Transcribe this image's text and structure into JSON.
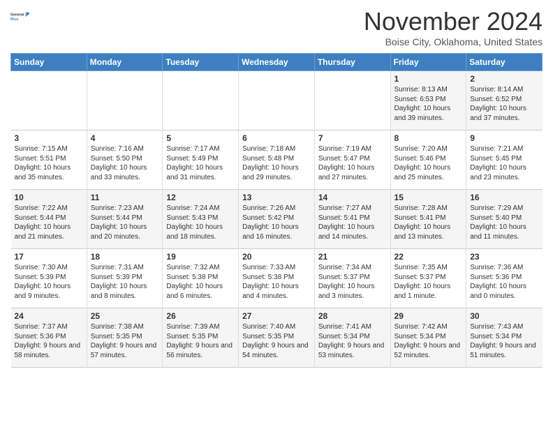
{
  "header": {
    "logo_line1": "General",
    "logo_line2": "Blue",
    "month": "November 2024",
    "location": "Boise City, Oklahoma, United States"
  },
  "weekdays": [
    "Sunday",
    "Monday",
    "Tuesday",
    "Wednesday",
    "Thursday",
    "Friday",
    "Saturday"
  ],
  "weeks": [
    [
      {
        "day": "",
        "info": ""
      },
      {
        "day": "",
        "info": ""
      },
      {
        "day": "",
        "info": ""
      },
      {
        "day": "",
        "info": ""
      },
      {
        "day": "",
        "info": ""
      },
      {
        "day": "1",
        "info": "Sunrise: 8:13 AM\nSunset: 6:53 PM\nDaylight: 10 hours and 39 minutes."
      },
      {
        "day": "2",
        "info": "Sunrise: 8:14 AM\nSunset: 6:52 PM\nDaylight: 10 hours and 37 minutes."
      }
    ],
    [
      {
        "day": "3",
        "info": "Sunrise: 7:15 AM\nSunset: 5:51 PM\nDaylight: 10 hours and 35 minutes."
      },
      {
        "day": "4",
        "info": "Sunrise: 7:16 AM\nSunset: 5:50 PM\nDaylight: 10 hours and 33 minutes."
      },
      {
        "day": "5",
        "info": "Sunrise: 7:17 AM\nSunset: 5:49 PM\nDaylight: 10 hours and 31 minutes."
      },
      {
        "day": "6",
        "info": "Sunrise: 7:18 AM\nSunset: 5:48 PM\nDaylight: 10 hours and 29 minutes."
      },
      {
        "day": "7",
        "info": "Sunrise: 7:19 AM\nSunset: 5:47 PM\nDaylight: 10 hours and 27 minutes."
      },
      {
        "day": "8",
        "info": "Sunrise: 7:20 AM\nSunset: 5:46 PM\nDaylight: 10 hours and 25 minutes."
      },
      {
        "day": "9",
        "info": "Sunrise: 7:21 AM\nSunset: 5:45 PM\nDaylight: 10 hours and 23 minutes."
      }
    ],
    [
      {
        "day": "10",
        "info": "Sunrise: 7:22 AM\nSunset: 5:44 PM\nDaylight: 10 hours and 21 minutes."
      },
      {
        "day": "11",
        "info": "Sunrise: 7:23 AM\nSunset: 5:44 PM\nDaylight: 10 hours and 20 minutes."
      },
      {
        "day": "12",
        "info": "Sunrise: 7:24 AM\nSunset: 5:43 PM\nDaylight: 10 hours and 18 minutes."
      },
      {
        "day": "13",
        "info": "Sunrise: 7:26 AM\nSunset: 5:42 PM\nDaylight: 10 hours and 16 minutes."
      },
      {
        "day": "14",
        "info": "Sunrise: 7:27 AM\nSunset: 5:41 PM\nDaylight: 10 hours and 14 minutes."
      },
      {
        "day": "15",
        "info": "Sunrise: 7:28 AM\nSunset: 5:41 PM\nDaylight: 10 hours and 13 minutes."
      },
      {
        "day": "16",
        "info": "Sunrise: 7:29 AM\nSunset: 5:40 PM\nDaylight: 10 hours and 11 minutes."
      }
    ],
    [
      {
        "day": "17",
        "info": "Sunrise: 7:30 AM\nSunset: 5:39 PM\nDaylight: 10 hours and 9 minutes."
      },
      {
        "day": "18",
        "info": "Sunrise: 7:31 AM\nSunset: 5:39 PM\nDaylight: 10 hours and 8 minutes."
      },
      {
        "day": "19",
        "info": "Sunrise: 7:32 AM\nSunset: 5:38 PM\nDaylight: 10 hours and 6 minutes."
      },
      {
        "day": "20",
        "info": "Sunrise: 7:33 AM\nSunset: 5:38 PM\nDaylight: 10 hours and 4 minutes."
      },
      {
        "day": "21",
        "info": "Sunrise: 7:34 AM\nSunset: 5:37 PM\nDaylight: 10 hours and 3 minutes."
      },
      {
        "day": "22",
        "info": "Sunrise: 7:35 AM\nSunset: 5:37 PM\nDaylight: 10 hours and 1 minute."
      },
      {
        "day": "23",
        "info": "Sunrise: 7:36 AM\nSunset: 5:36 PM\nDaylight: 10 hours and 0 minutes."
      }
    ],
    [
      {
        "day": "24",
        "info": "Sunrise: 7:37 AM\nSunset: 5:36 PM\nDaylight: 9 hours and 58 minutes."
      },
      {
        "day": "25",
        "info": "Sunrise: 7:38 AM\nSunset: 5:35 PM\nDaylight: 9 hours and 57 minutes."
      },
      {
        "day": "26",
        "info": "Sunrise: 7:39 AM\nSunset: 5:35 PM\nDaylight: 9 hours and 56 minutes."
      },
      {
        "day": "27",
        "info": "Sunrise: 7:40 AM\nSunset: 5:35 PM\nDaylight: 9 hours and 54 minutes."
      },
      {
        "day": "28",
        "info": "Sunrise: 7:41 AM\nSunset: 5:34 PM\nDaylight: 9 hours and 53 minutes."
      },
      {
        "day": "29",
        "info": "Sunrise: 7:42 AM\nSunset: 5:34 PM\nDaylight: 9 hours and 52 minutes."
      },
      {
        "day": "30",
        "info": "Sunrise: 7:43 AM\nSunset: 5:34 PM\nDaylight: 9 hours and 51 minutes."
      }
    ]
  ]
}
